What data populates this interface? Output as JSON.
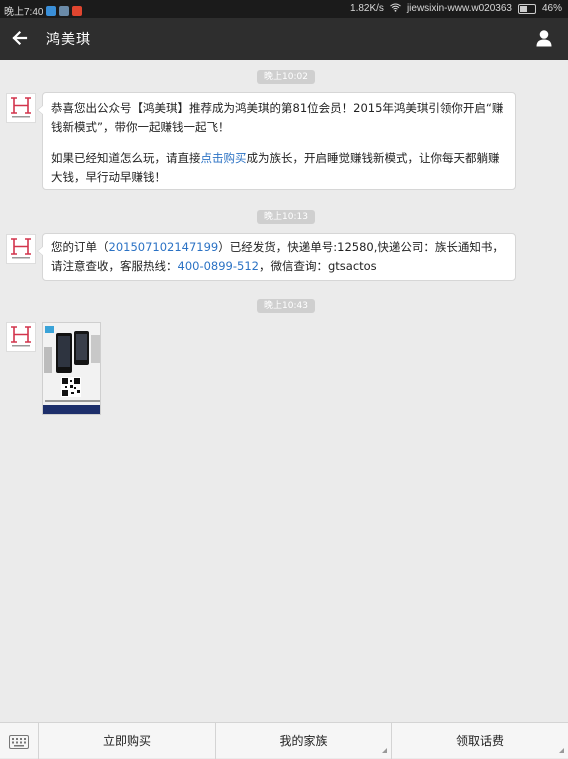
{
  "status_bar": {
    "time": "晚上7:40",
    "network_speed": "1.82K/s",
    "wifi_name": "jiewsixin-www.w020363",
    "battery": "46%"
  },
  "header": {
    "title": "鸿美琪"
  },
  "messages": [
    {
      "time": "晚上10:02",
      "paragraph1": "恭喜您出公众号【鸿美琪】推荐成为鸿美琪的第81位会员！2015年鸿美琪引领你开启“赚钱新模式”，带你一起赚钱一起飞！",
      "paragraph2_before": "如果已经知道怎么玩，请直接",
      "paragraph2_link": "点击购买",
      "paragraph2_after": "成为族长，开启睡觉赚钱新模式，让你每天都躺赚大钱，早行动早赚钱！"
    },
    {
      "time": "晚上10:13",
      "before_order": "您的订单（",
      "order_no": "201507102147199",
      "after_order": "）已经发货，快递单号:12580,快递公司：族长通知书，请注意查收，客服热线：",
      "hotline": "400-0899-512",
      "after_hotline": "，微信查询：gtsactos"
    },
    {
      "time": "晚上10:43"
    }
  ],
  "bottom_menu": {
    "item1": "立即购买",
    "item2": "我的家族",
    "item3": "领取话费"
  },
  "colors": {
    "header_bg": "#2e2e2e",
    "link": "#2b72c4",
    "brand_red": "#d2344c"
  }
}
